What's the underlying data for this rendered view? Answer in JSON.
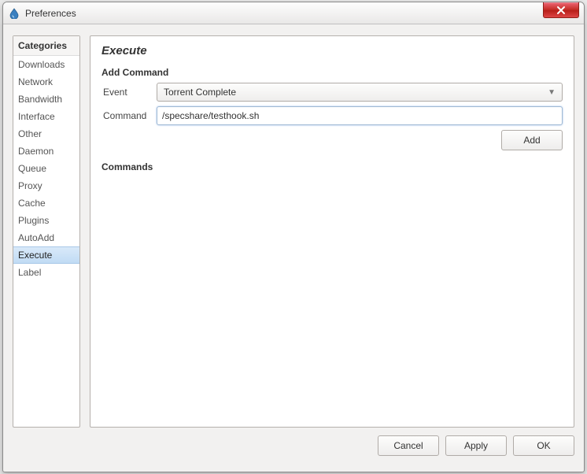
{
  "window": {
    "title": "Preferences"
  },
  "sidebar": {
    "header": "Categories",
    "items": [
      {
        "label": "Downloads",
        "selected": false
      },
      {
        "label": "Network",
        "selected": false
      },
      {
        "label": "Bandwidth",
        "selected": false
      },
      {
        "label": "Interface",
        "selected": false
      },
      {
        "label": "Other",
        "selected": false
      },
      {
        "label": "Daemon",
        "selected": false
      },
      {
        "label": "Queue",
        "selected": false
      },
      {
        "label": "Proxy",
        "selected": false
      },
      {
        "label": "Cache",
        "selected": false
      },
      {
        "label": "Plugins",
        "selected": false
      },
      {
        "label": "AutoAdd",
        "selected": false
      },
      {
        "label": "Execute",
        "selected": true
      },
      {
        "label": "Label",
        "selected": false
      }
    ]
  },
  "main": {
    "title": "Execute",
    "add_section": {
      "header": "Add Command",
      "event_label": "Event",
      "event_value": "Torrent Complete",
      "command_label": "Command",
      "command_value": "/specshare/testhook.sh",
      "add_button": "Add"
    },
    "commands_section": {
      "header": "Commands"
    }
  },
  "footer": {
    "cancel": "Cancel",
    "apply": "Apply",
    "ok": "OK"
  }
}
